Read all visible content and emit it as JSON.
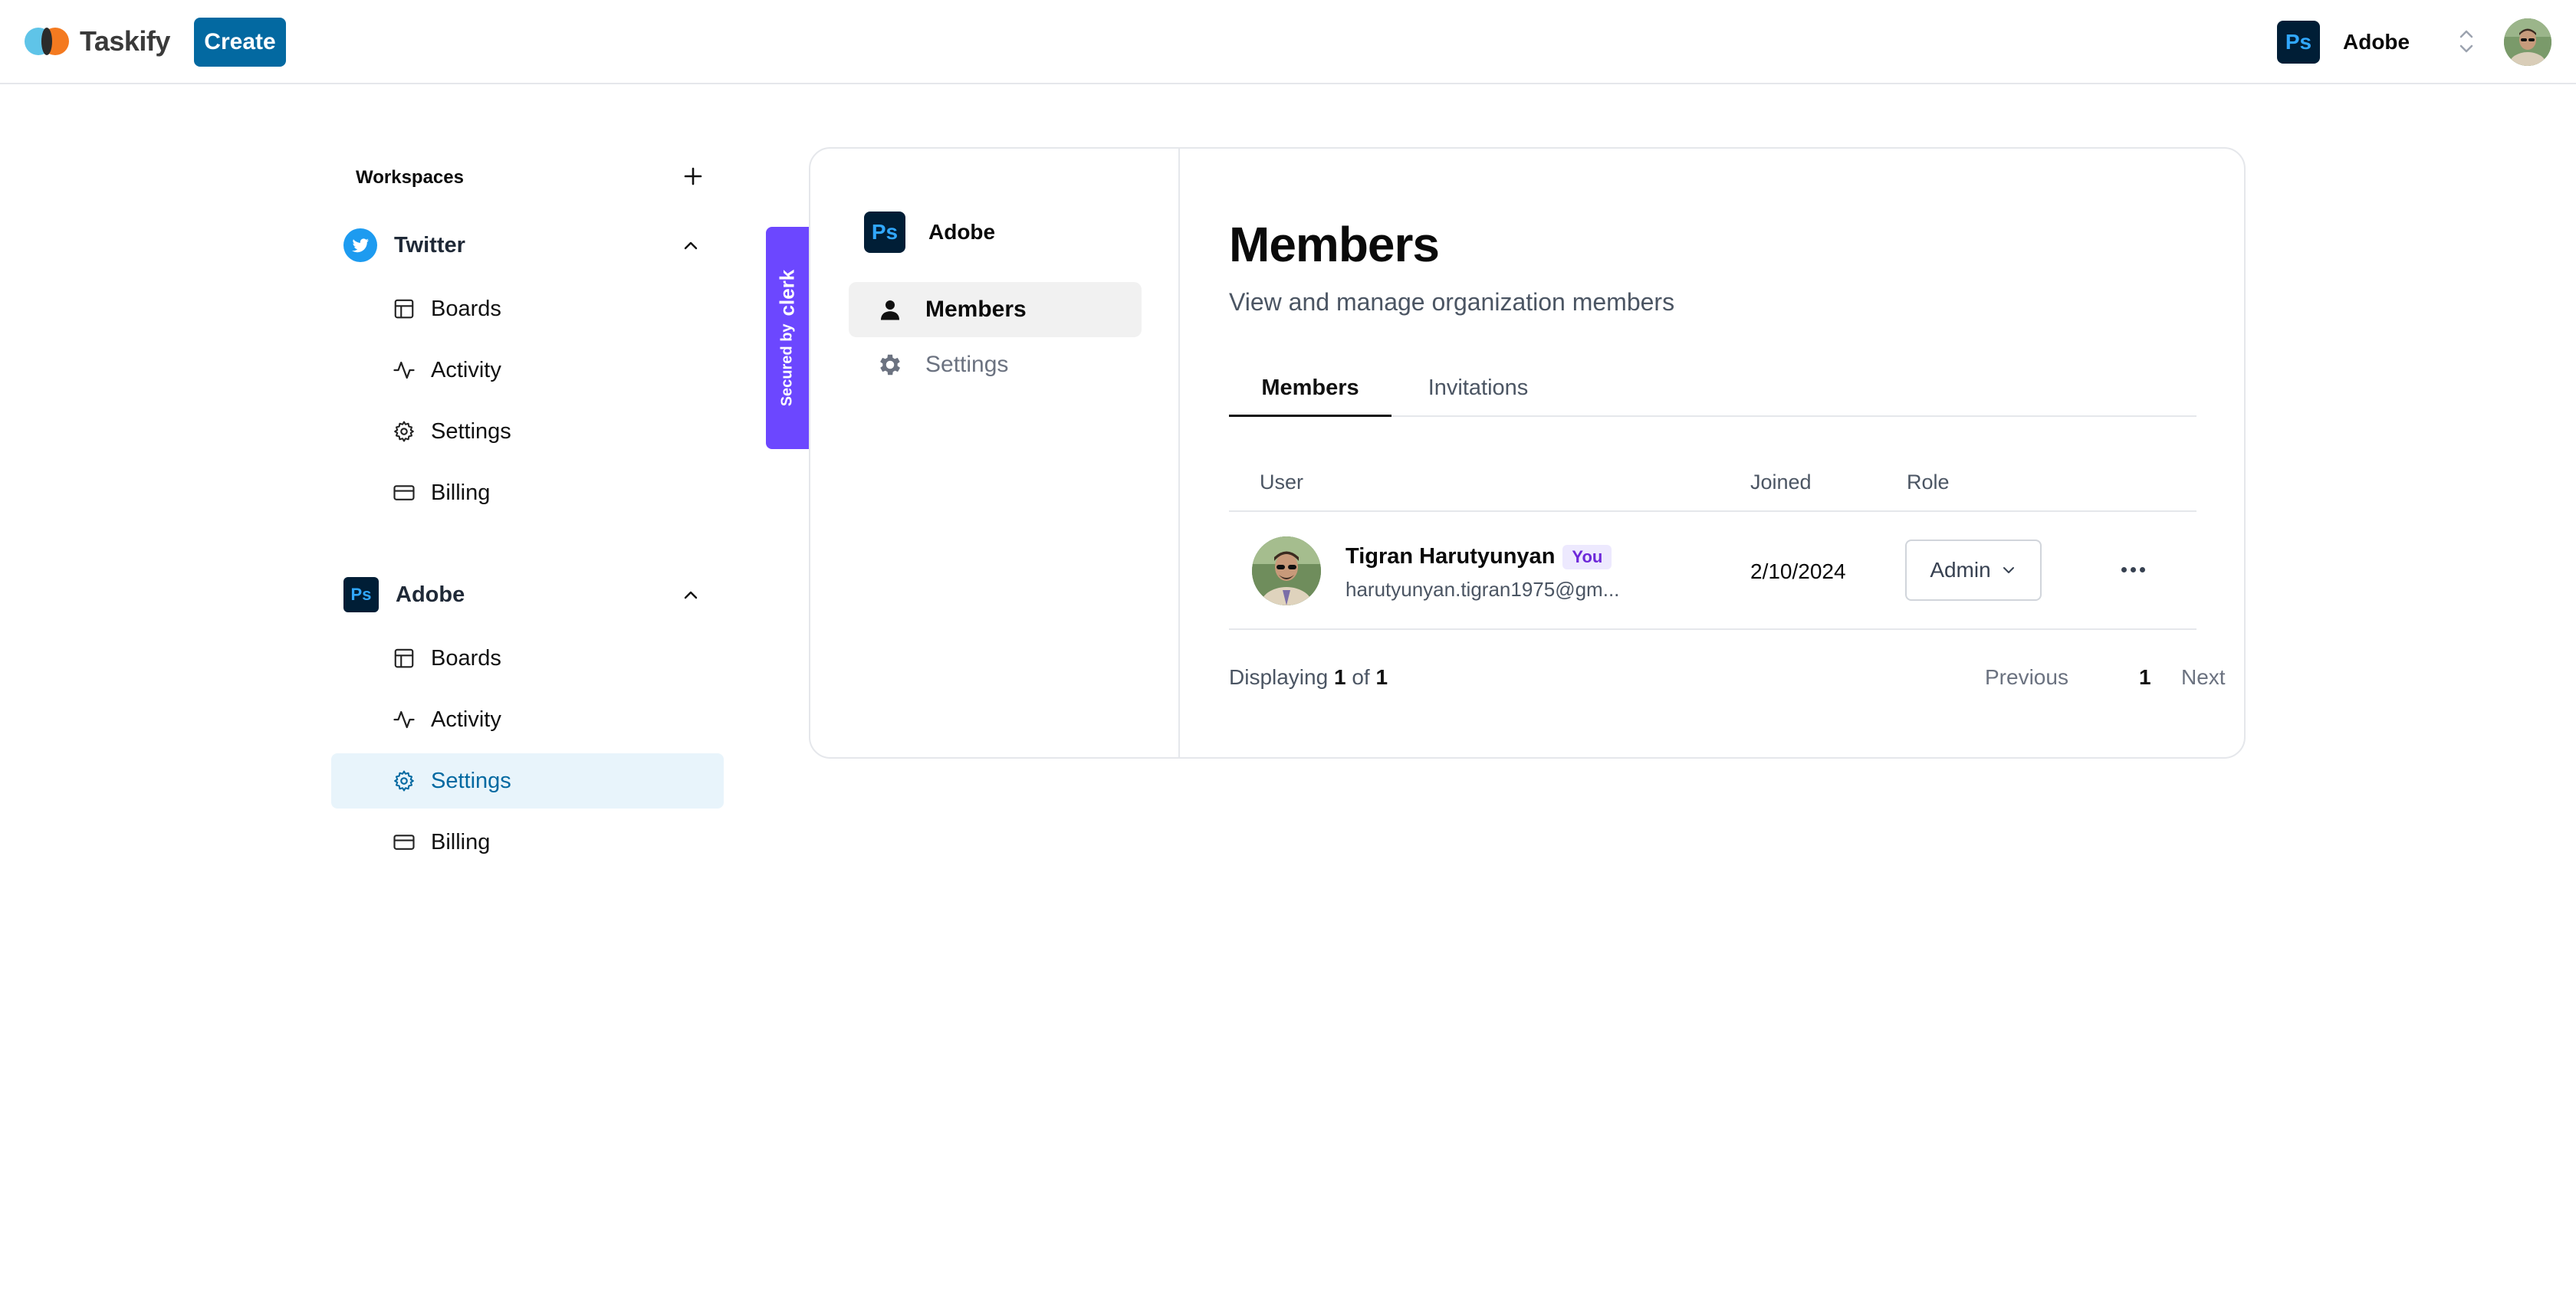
{
  "topnav": {
    "brand": "Taskify",
    "create_label": "Create",
    "org_switcher": {
      "logo": "Ps",
      "name": "Adobe"
    },
    "icons": {
      "switcher": "chevron-up-down-icon",
      "avatar": "user-avatar"
    }
  },
  "sidebar": {
    "header": "Workspaces",
    "add_icon": "plus-icon",
    "workspaces": [
      {
        "name": "Twitter",
        "icon": "twitter-icon",
        "expanded": true,
        "items": [
          {
            "label": "Boards",
            "icon": "layout-icon"
          },
          {
            "label": "Activity",
            "icon": "activity-icon"
          },
          {
            "label": "Settings",
            "icon": "gear-icon"
          },
          {
            "label": "Billing",
            "icon": "credit-card-icon"
          }
        ]
      },
      {
        "name": "Adobe",
        "logo": "Ps",
        "expanded": true,
        "items": [
          {
            "label": "Boards",
            "icon": "layout-icon"
          },
          {
            "label": "Activity",
            "icon": "activity-icon"
          },
          {
            "label": "Settings",
            "icon": "gear-icon",
            "active": true
          },
          {
            "label": "Billing",
            "icon": "credit-card-icon"
          }
        ]
      }
    ]
  },
  "clerk_badge": {
    "prefix": "Secured by",
    "brand": "clerk"
  },
  "org_profile": {
    "nav": {
      "org_logo": "Ps",
      "org_name": "Adobe",
      "items": [
        {
          "label": "Members",
          "icon": "user-icon",
          "active": true
        },
        {
          "label": "Settings",
          "icon": "gear-icon",
          "active": false
        }
      ]
    },
    "title": "Members",
    "subtitle": "View and manage organization members",
    "tabs": [
      {
        "label": "Members",
        "active": true
      },
      {
        "label": "Invitations",
        "active": false
      }
    ],
    "table": {
      "columns": [
        "User",
        "Joined",
        "Role"
      ],
      "rows": [
        {
          "name": "Tigran Harutyunyan",
          "badge": "You",
          "email": "harutyunyan.tigran1975@gm...",
          "joined": "2/10/2024",
          "role": "Admin"
        }
      ]
    },
    "pagination": {
      "prefix": "Displaying",
      "current": "1",
      "of": "of",
      "total": "1",
      "previous": "Previous",
      "page": "1",
      "next": "Next"
    }
  },
  "colors": {
    "primary": "#0369a1",
    "active_bg": "#e8f4fb",
    "clerk_purple": "#6c47ff",
    "photoshop_bg": "#001e36",
    "photoshop_fg": "#31a8ff",
    "twitter_blue": "#1d9bf0"
  }
}
